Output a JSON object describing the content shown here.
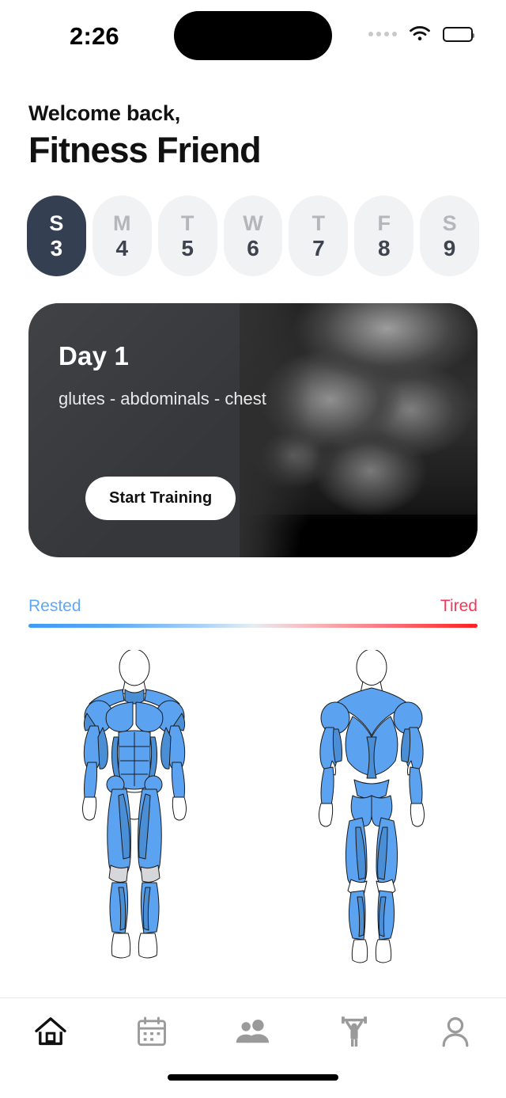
{
  "status_bar": {
    "time": "2:26",
    "signal_icon": "signal-dots-icon",
    "wifi_icon": "wifi-icon",
    "battery_icon": "battery-icon"
  },
  "header": {
    "greeting_small": "Welcome back,",
    "greeting_name": "Fitness Friend"
  },
  "day_selector": {
    "days": [
      {
        "letter": "S",
        "number": "3",
        "active": true
      },
      {
        "letter": "M",
        "number": "4",
        "active": false
      },
      {
        "letter": "T",
        "number": "5",
        "active": false
      },
      {
        "letter": "W",
        "number": "6",
        "active": false
      },
      {
        "letter": "T",
        "number": "7",
        "active": false
      },
      {
        "letter": "F",
        "number": "8",
        "active": false
      },
      {
        "letter": "S",
        "number": "9",
        "active": false
      }
    ],
    "active_color": "#343f52",
    "inactive_color": "#f1f2f4"
  },
  "workout_card": {
    "day_title": "Day  1",
    "muscle_groups": "glutes - abdominals - chest",
    "start_button": "Start Training",
    "background_color": "#35373b",
    "photo_alt": "bodybuilder-photo"
  },
  "fatigue_meter": {
    "left_label": "Rested",
    "right_label": "Tired",
    "left_color": "#5fa8f5",
    "right_color": "#f8365a"
  },
  "muscle_map": {
    "front_label": "front-body-muscle-diagram",
    "back_label": "back-body-muscle-diagram",
    "muscle_color": "#5ba3f0",
    "muscle_shade_color": "#4a8fd6"
  },
  "tab_bar": {
    "tabs": [
      {
        "name": "home",
        "icon": "home-icon",
        "active": true
      },
      {
        "name": "calendar",
        "icon": "calendar-icon",
        "active": false
      },
      {
        "name": "community",
        "icon": "people-icon",
        "active": false
      },
      {
        "name": "workouts",
        "icon": "weightlifter-icon",
        "active": false
      },
      {
        "name": "profile",
        "icon": "person-icon",
        "active": false
      }
    ],
    "active_color": "#111111",
    "inactive_color": "#9a9a9a"
  }
}
